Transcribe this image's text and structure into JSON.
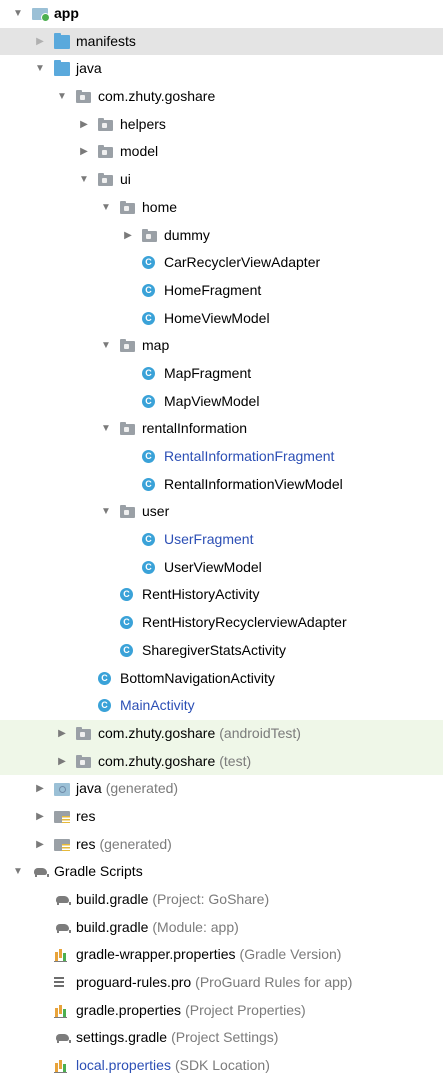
{
  "tree": [
    {
      "key": "app",
      "depth": 0,
      "arrow": "down",
      "icon": "app-module-icon",
      "name": "app",
      "bold": true
    },
    {
      "key": "manifests",
      "depth": 1,
      "arrow": "right",
      "icon": "folder-icon",
      "name": "manifests",
      "selected": true
    },
    {
      "key": "java",
      "depth": 1,
      "arrow": "down",
      "icon": "folder-icon",
      "name": "java"
    },
    {
      "key": "pkg-main",
      "depth": 2,
      "arrow": "down",
      "icon": "package-icon",
      "name": "com.zhuty.goshare"
    },
    {
      "key": "helpers",
      "depth": 3,
      "arrow": "right",
      "icon": "package-icon",
      "name": "helpers"
    },
    {
      "key": "model",
      "depth": 3,
      "arrow": "right",
      "icon": "package-icon",
      "name": "model"
    },
    {
      "key": "ui",
      "depth": 3,
      "arrow": "down",
      "icon": "package-icon",
      "name": "ui"
    },
    {
      "key": "home",
      "depth": 4,
      "arrow": "down",
      "icon": "package-icon",
      "name": "home"
    },
    {
      "key": "dummy",
      "depth": 5,
      "arrow": "right",
      "icon": "package-icon",
      "name": "dummy"
    },
    {
      "key": "CarRecyclerViewAdapter",
      "depth": 5,
      "icon": "class-icon",
      "name": "CarRecyclerViewAdapter"
    },
    {
      "key": "HomeFragment",
      "depth": 5,
      "icon": "class-icon",
      "name": "HomeFragment"
    },
    {
      "key": "HomeViewModel",
      "depth": 5,
      "icon": "class-icon",
      "name": "HomeViewModel"
    },
    {
      "key": "map",
      "depth": 4,
      "arrow": "down",
      "icon": "package-icon",
      "name": "map"
    },
    {
      "key": "MapFragment",
      "depth": 5,
      "icon": "class-icon",
      "name": "MapFragment"
    },
    {
      "key": "MapViewModel",
      "depth": 5,
      "icon": "class-icon",
      "name": "MapViewModel"
    },
    {
      "key": "rentalInformation",
      "depth": 4,
      "arrow": "down",
      "icon": "package-icon",
      "name": "rentalInformation"
    },
    {
      "key": "RentalInformationFragment",
      "depth": 5,
      "icon": "class-icon",
      "name": "RentalInformationFragment",
      "blue": true
    },
    {
      "key": "RentalInformationViewModel",
      "depth": 5,
      "icon": "class-icon",
      "name": "RentalInformationViewModel"
    },
    {
      "key": "user",
      "depth": 4,
      "arrow": "down",
      "icon": "package-icon",
      "name": "user"
    },
    {
      "key": "UserFragment",
      "depth": 5,
      "icon": "class-icon",
      "name": "UserFragment",
      "blue": true
    },
    {
      "key": "UserViewModel",
      "depth": 5,
      "icon": "class-icon",
      "name": "UserViewModel"
    },
    {
      "key": "RentHistoryActivity",
      "depth": 4,
      "icon": "class-icon",
      "name": "RentHistoryActivity"
    },
    {
      "key": "RentHistoryRecyclerviewAdapter",
      "depth": 4,
      "icon": "class-icon",
      "name": "RentHistoryRecyclerviewAdapter"
    },
    {
      "key": "SharegiverStatsActivity",
      "depth": 4,
      "icon": "class-icon",
      "name": "SharegiverStatsActivity"
    },
    {
      "key": "BottomNavigationActivity",
      "depth": 3,
      "icon": "class-icon",
      "name": "BottomNavigationActivity"
    },
    {
      "key": "MainActivity",
      "depth": 3,
      "icon": "class-icon",
      "name": "MainActivity",
      "blue": true
    },
    {
      "key": "pkg-androidTest",
      "depth": 2,
      "arrow": "right",
      "icon": "package-icon",
      "name": "com.zhuty.goshare",
      "suffix": "(androidTest)",
      "test": true
    },
    {
      "key": "pkg-test",
      "depth": 2,
      "arrow": "right",
      "icon": "package-icon",
      "name": "com.zhuty.goshare",
      "suffix": "(test)",
      "test": true
    },
    {
      "key": "java-generated",
      "depth": 1,
      "arrow": "right",
      "icon": "generated-folder-icon",
      "name": "java",
      "suffix": "(generated)"
    },
    {
      "key": "res",
      "depth": 1,
      "arrow": "right",
      "icon": "res-folder-icon",
      "name": "res"
    },
    {
      "key": "res-generated",
      "depth": 1,
      "arrow": "right",
      "icon": "res-folder-icon",
      "name": "res",
      "suffix": "(generated)"
    },
    {
      "key": "gradle-scripts",
      "depth": 0,
      "arrow": "down",
      "icon": "gradle-icon",
      "name": "Gradle Scripts"
    },
    {
      "key": "build-project",
      "depth": 1,
      "icon": "gradle-icon",
      "name": "build.gradle",
      "suffix": "(Project: GoShare)"
    },
    {
      "key": "build-module",
      "depth": 1,
      "icon": "gradle-icon",
      "name": "build.gradle",
      "suffix": "(Module: app)"
    },
    {
      "key": "gradle-wrapper",
      "depth": 1,
      "icon": "properties-icon",
      "name": "gradle-wrapper.properties",
      "suffix": "(Gradle Version)"
    },
    {
      "key": "proguard",
      "depth": 1,
      "icon": "text-file-icon",
      "name": "proguard-rules.pro",
      "suffix": "(ProGuard Rules for app)"
    },
    {
      "key": "gradle-properties",
      "depth": 1,
      "icon": "properties-icon",
      "name": "gradle.properties",
      "suffix": "(Project Properties)"
    },
    {
      "key": "settings-gradle",
      "depth": 1,
      "icon": "gradle-icon",
      "name": "settings.gradle",
      "suffix": "(Project Settings)"
    },
    {
      "key": "local-properties",
      "depth": 1,
      "icon": "properties-icon",
      "name": "local.properties",
      "suffix": "(SDK Location)",
      "blue": true
    }
  ]
}
